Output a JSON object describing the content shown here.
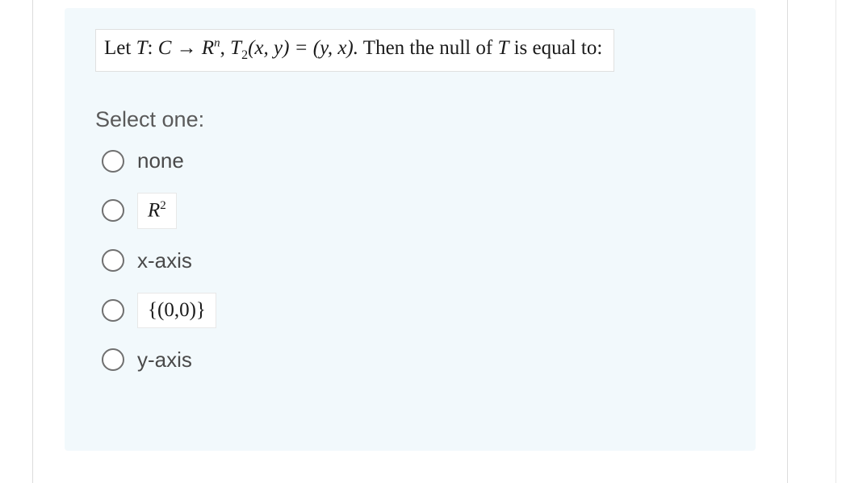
{
  "question": {
    "prefix": "Let  ",
    "math1_T": "T",
    "math1_colon": ": ",
    "math1_C": "C",
    "math1_arrow": " → ",
    "math1_R": "R",
    "math1_sup": "n",
    "math1_comma": ",  ",
    "math1_T2": "T",
    "math1_sub": "2",
    "math1_args": "(x, y) = (y, x).",
    "suffix": "  Then the null of ",
    "math2_T": "T",
    "suffix2": "  is equal to:"
  },
  "prompt": "Select one:",
  "options": [
    {
      "type": "text",
      "label": "none"
    },
    {
      "type": "image",
      "label_R": "R",
      "label_sup": "2"
    },
    {
      "type": "text",
      "label": "x-axis"
    },
    {
      "type": "image",
      "label": "{(0,0)}"
    },
    {
      "type": "text",
      "label": "y-axis"
    }
  ]
}
